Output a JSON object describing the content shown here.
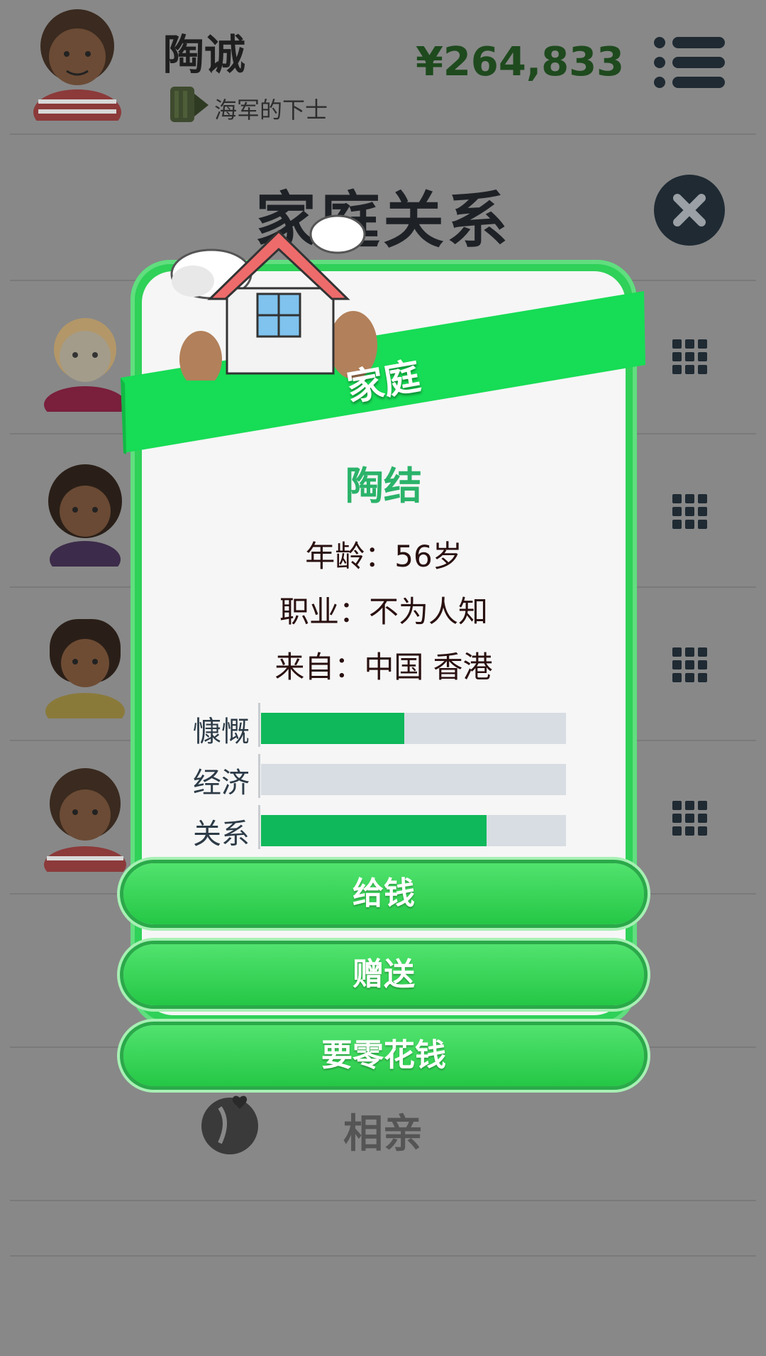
{
  "header": {
    "player_name": "陶诚",
    "rank": "海军的下士",
    "money": "¥264,833"
  },
  "page": {
    "title": "家庭关系",
    "blind_date_label": "相亲"
  },
  "modal": {
    "ribbon_title": "家庭",
    "person_name": "陶结",
    "age_line": "年龄：56岁",
    "job_line": "职业：不为人知",
    "from_line": "来自：中国 香港",
    "stats": [
      {
        "label": "慷慨",
        "value": 0.47
      },
      {
        "label": "经济",
        "value": 0.0
      },
      {
        "label": "关系",
        "value": 0.74
      }
    ],
    "buttons": [
      "给钱",
      "赠送",
      "要零花钱"
    ]
  },
  "icons": {
    "menu": "menu-icon",
    "close": "close-icon",
    "grid": "grid-icon",
    "rank": "army-rank-icon",
    "house": "house-icon",
    "blind_date": "couple-heart-icon"
  },
  "colors": {
    "accent_green": "#2fd158",
    "bar_fill": "#0fb85a",
    "money": "#1e4a1e"
  }
}
